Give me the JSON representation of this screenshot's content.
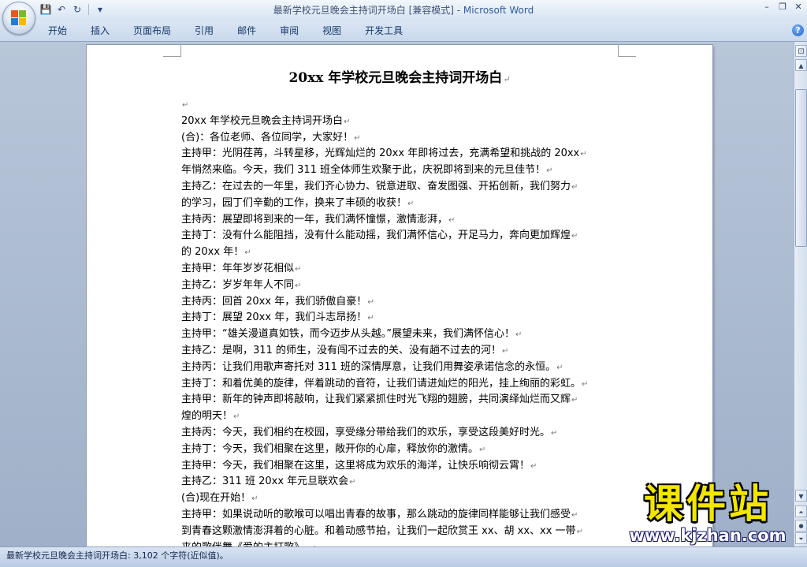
{
  "window": {
    "title": "最新学校元旦晚会主持词开场白 [兼容模式] - ",
    "app_name": "Microsoft Word",
    "controls": [
      "–",
      "❐",
      "✕"
    ]
  },
  "quick_access": {
    "save_icon": "💾",
    "undo_icon": "↶",
    "redo_icon": "↻",
    "customize_icon": "▾"
  },
  "ribbon": {
    "tabs": [
      "开始",
      "插入",
      "页面布局",
      "引用",
      "邮件",
      "审阅",
      "视图",
      "开发工具"
    ],
    "help_icon": "?"
  },
  "document": {
    "title": "20xx 年学校元旦晚会主持词开场白",
    "paragraph_mark": "↵",
    "lines": [
      "",
      "20xx 年学校元旦晚会主持词开场白",
      "(合)：各位老师、各位同学，大家好！",
      "主持甲：光阴荏苒，斗转星移，光辉灿烂的 20xx 年即将过去，充满希望和挑战的 20xx",
      "年悄然来临。今天，我们 311 班全体师生欢聚于此，庆祝即将到来的元旦佳节！",
      "主持乙：在过去的一年里，我们齐心协力、锐意进取、奋发图强、开拓创新，我们努力",
      "的学习，园丁们辛勤的工作，换来了丰硕的收获！",
      "主持丙：展望即将到来的一年，我们满怀憧憬，激情澎湃，",
      "主持丁：没有什么能阻挡，没有什么能动摇，我们满怀信心，开足马力，奔向更加辉煌",
      "的 20xx 年！",
      "主持甲：年年岁岁花相似",
      "主持乙：岁岁年年人不同",
      "主持丙：回首 20xx 年，我们骄傲自豪！",
      "主持丁：展望 20xx 年，我们斗志昂扬！",
      "主持甲：“雄关漫道真如铁，而今迈步从头越。”展望未来，我们满怀信心！",
      "主持乙：是啊，311 的师生，没有闯不过去的关、没有趟不过去的河！",
      "主持丙：让我们用歌声寄托对 311 班的深情厚意，让我们用舞姿承诺信念的永恒。",
      "主持丁：和着优美的旋律，伴着跳动的音符，让我们请进灿烂的阳光，挂上绚丽的彩虹。",
      "主持甲：新年的钟声即将敲响，让我们紧紧抓住时光飞翔的翅膀，共同演绎灿烂而又辉",
      "煌的明天！",
      "主持丙：今天，我们相约在校园，享受缘分带给我们的欢乐，享受这段美好时光。",
      "主持丁：今天，我们相聚在这里，敞开你的心扉，释放你的激情。",
      "主持甲：今天，我们相聚在这里，这里将成为欢乐的海洋，让快乐响彻云霄！",
      "主持乙：311 班 20xx 年元旦联欢会",
      "(合)现在开始！",
      "主持甲：如果说动听的歌喉可以唱出青春的故事，那么跳动的旋律同样能够让我们感受",
      "到青春这颗激情澎湃着的心脏。和着动感节拍，让我们一起欣赏王 xx、胡 xx、xx 一带",
      "来的歌伴舞《爱的主打歌》。"
    ]
  },
  "statusbar": {
    "text": "最新学校元旦晚会主持词开场白: 3,102 个字符(近似值)。"
  },
  "watermark": {
    "cn": "课件站",
    "url": "www.kjzhan.com"
  },
  "scrollbar": {
    "ruler_icon": "⊡",
    "up_icon": "▲",
    "down_icon": "▼",
    "prev_icon": "⏶",
    "browse_icon": "●",
    "next_icon": "⏷"
  }
}
